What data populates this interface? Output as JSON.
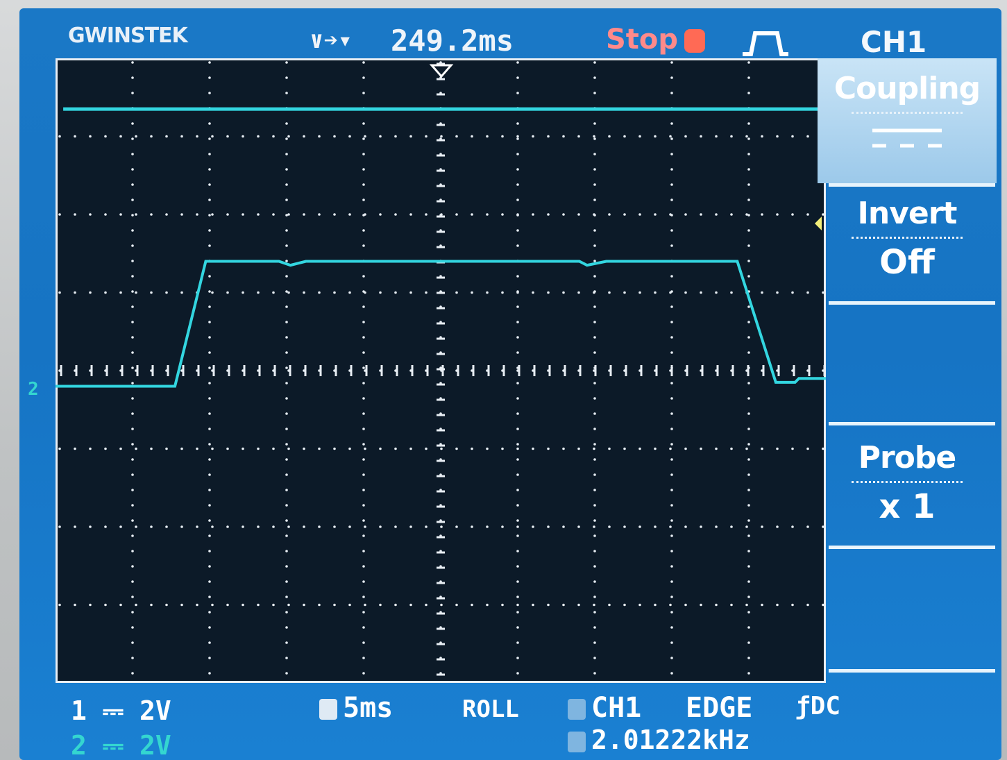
{
  "header": {
    "brand": "GWINSTEK",
    "timebase_marker": "∨➔▾",
    "trigger_position": "249.2ms",
    "run_state": "Stop",
    "channel": "CH1"
  },
  "menu": {
    "coupling": {
      "title": "Coupling",
      "value": "DC"
    },
    "invert": {
      "title": "Invert",
      "value": "Off"
    },
    "probe": {
      "title": "Probe",
      "value": "x 1"
    }
  },
  "footer": {
    "ch1_scale": "1 ⎓ 2V",
    "ch2_scale": "2 ⎓ 2V",
    "timebase": "5ms",
    "mode": "ROLL",
    "trigger_source": "CH1",
    "trigger_type": "EDGE",
    "trigger_coupling": "ƒDC",
    "frequency": "2.01222kHz"
  },
  "markers": {
    "ch2_ground": "2"
  },
  "colors": {
    "screen_bg": "#1674c4",
    "graticule_bg": "#0c1a28",
    "trace_ch1": "#33d6e0",
    "trace_ch2": "#33d6e0",
    "run_state": "#ff8a8a",
    "menu_text": "#ffffff"
  },
  "trace": {
    "ch1_level_div": 3.35,
    "ch2_waveform_div": [
      [
        0.0,
        -0.2
      ],
      [
        1.55,
        -0.2
      ],
      [
        1.95,
        1.4
      ],
      [
        2.9,
        1.4
      ],
      [
        3.05,
        1.35
      ],
      [
        3.25,
        1.4
      ],
      [
        6.8,
        1.4
      ],
      [
        6.9,
        1.35
      ],
      [
        7.15,
        1.4
      ],
      [
        8.85,
        1.4
      ],
      [
        9.35,
        -0.15
      ],
      [
        9.6,
        -0.15
      ],
      [
        9.65,
        -0.1
      ],
      [
        10.0,
        -0.1
      ]
    ]
  }
}
